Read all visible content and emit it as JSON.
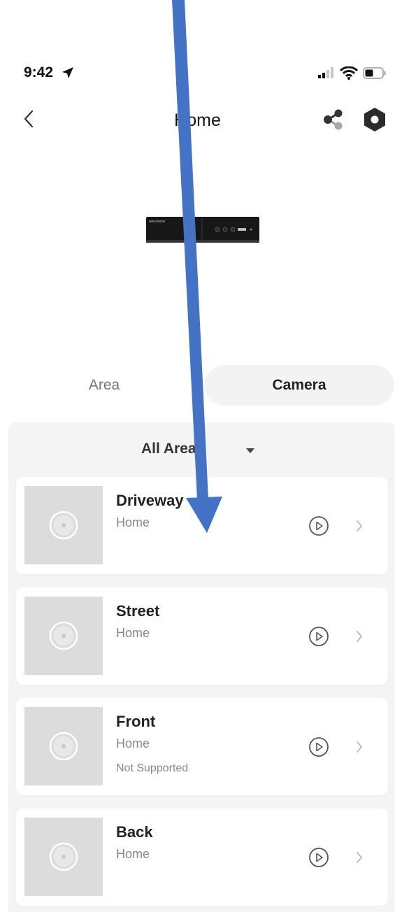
{
  "status_bar": {
    "time": "9:42"
  },
  "header": {
    "title": "Home"
  },
  "tabs": [
    {
      "label": "Area"
    },
    {
      "label": "Camera"
    }
  ],
  "filter": {
    "label": "All Areas"
  },
  "cameras": [
    {
      "name": "Driveway",
      "area": "Home",
      "status": ""
    },
    {
      "name": "Street",
      "area": "Home",
      "status": ""
    },
    {
      "name": "Front",
      "area": "Home",
      "status": "Not Supported"
    },
    {
      "name": "Back",
      "area": "Home",
      "status": ""
    }
  ],
  "device_logo": "HIKVISION",
  "colors": {
    "annotation_arrow": "#4472c4",
    "panel_bg": "#f4f4f4",
    "thumb_bg": "#dcdcdc"
  },
  "icons": {
    "location": "location-arrow-icon",
    "signal": "signal-bars-icon",
    "wifi": "wifi-icon",
    "battery": "battery-icon",
    "back": "chevron-left-icon",
    "share": "share-icon",
    "settings": "hexagon-settings-icon",
    "play": "play-circle-icon",
    "open": "chevron-right-icon"
  }
}
